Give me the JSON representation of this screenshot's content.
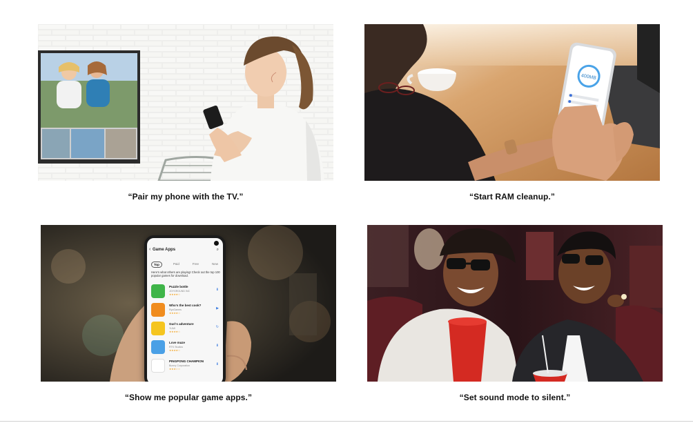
{
  "cards": [
    {
      "caption": "“Pair my phone with the TV.”",
      "image": "woman-with-phone-and-tv"
    },
    {
      "caption": "“Start RAM cleanup.”",
      "image": "hands-holding-phone-ram-cleanup"
    },
    {
      "caption": "“Show me popular game apps.”",
      "image": "hand-holding-phone-game-apps"
    },
    {
      "caption": "“Set sound mode to silent.”",
      "image": "couple-in-3d-movie-theater"
    }
  ],
  "ram_screen": {
    "value": "400",
    "unit": "MB"
  },
  "game_apps_screen": {
    "title": "Game Apps",
    "tabs": [
      "Top",
      "Paid",
      "Free",
      "New"
    ],
    "active_tab": "Top",
    "description": "Here's what others are playing! Check out the top 100 popular games for download.",
    "apps": [
      {
        "name": "Puzzle bottle",
        "publisher": "JOYGROUND INC",
        "icon_color": "#3fb549"
      },
      {
        "name": "Who's the best cook?",
        "publisher": "RyoGames",
        "icon_color": "#f08c1e"
      },
      {
        "name": "Guri's adventure",
        "publisher": "YUMI",
        "icon_color": "#f5c51f"
      },
      {
        "name": "Love maze",
        "publisher": "RTK Studios",
        "icon_color": "#4aa0e6"
      },
      {
        "name": "PINGPONG CHAMPION",
        "publisher": "Bunny Corporation",
        "icon_color": "#e8473d"
      }
    ]
  },
  "colors": {
    "background": "#ffffff",
    "caption_text": "#111111",
    "divider": "#cfcfcf"
  }
}
